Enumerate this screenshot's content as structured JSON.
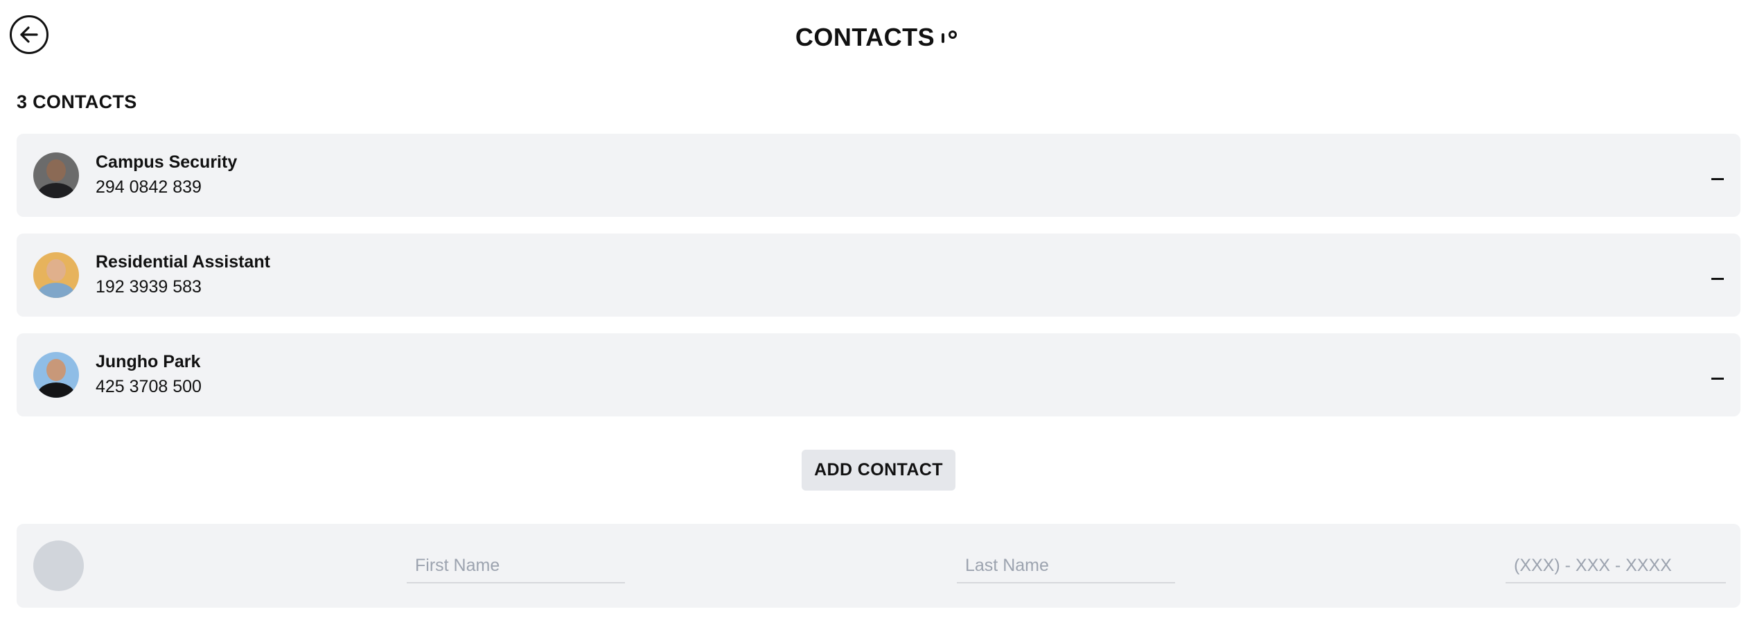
{
  "header": {
    "title": "CONTACTS",
    "back_icon": "arrow-left-circle-icon"
  },
  "contacts_count_label": "3 CONTACTS",
  "contacts": [
    {
      "name": "Campus Security",
      "phone": "294 0842 839",
      "avatar_colors": {
        "bg": "#6b6b6b",
        "head": "#8b6a55",
        "body": "#1f1f22"
      }
    },
    {
      "name": "Residential Assistant",
      "phone": "192 3939 583",
      "avatar_colors": {
        "bg": "#e7b35c",
        "head": "#e0b08c",
        "body": "#7fa6c9"
      }
    },
    {
      "name": "Jungho Park",
      "phone": "425 3708 500",
      "avatar_colors": {
        "bg": "#8fbde6",
        "head": "#c89879",
        "body": "#141416"
      }
    }
  ],
  "add_contact_label": "ADD CONTACT",
  "new_contact": {
    "first_placeholder": "First Name",
    "last_placeholder": "Last Name",
    "phone_placeholder": "(XXX) - XXX - XXXX"
  },
  "colors": {
    "row_bg": "#f2f3f5",
    "button_bg": "#e5e7eb",
    "placeholder": "#9ca3af"
  }
}
